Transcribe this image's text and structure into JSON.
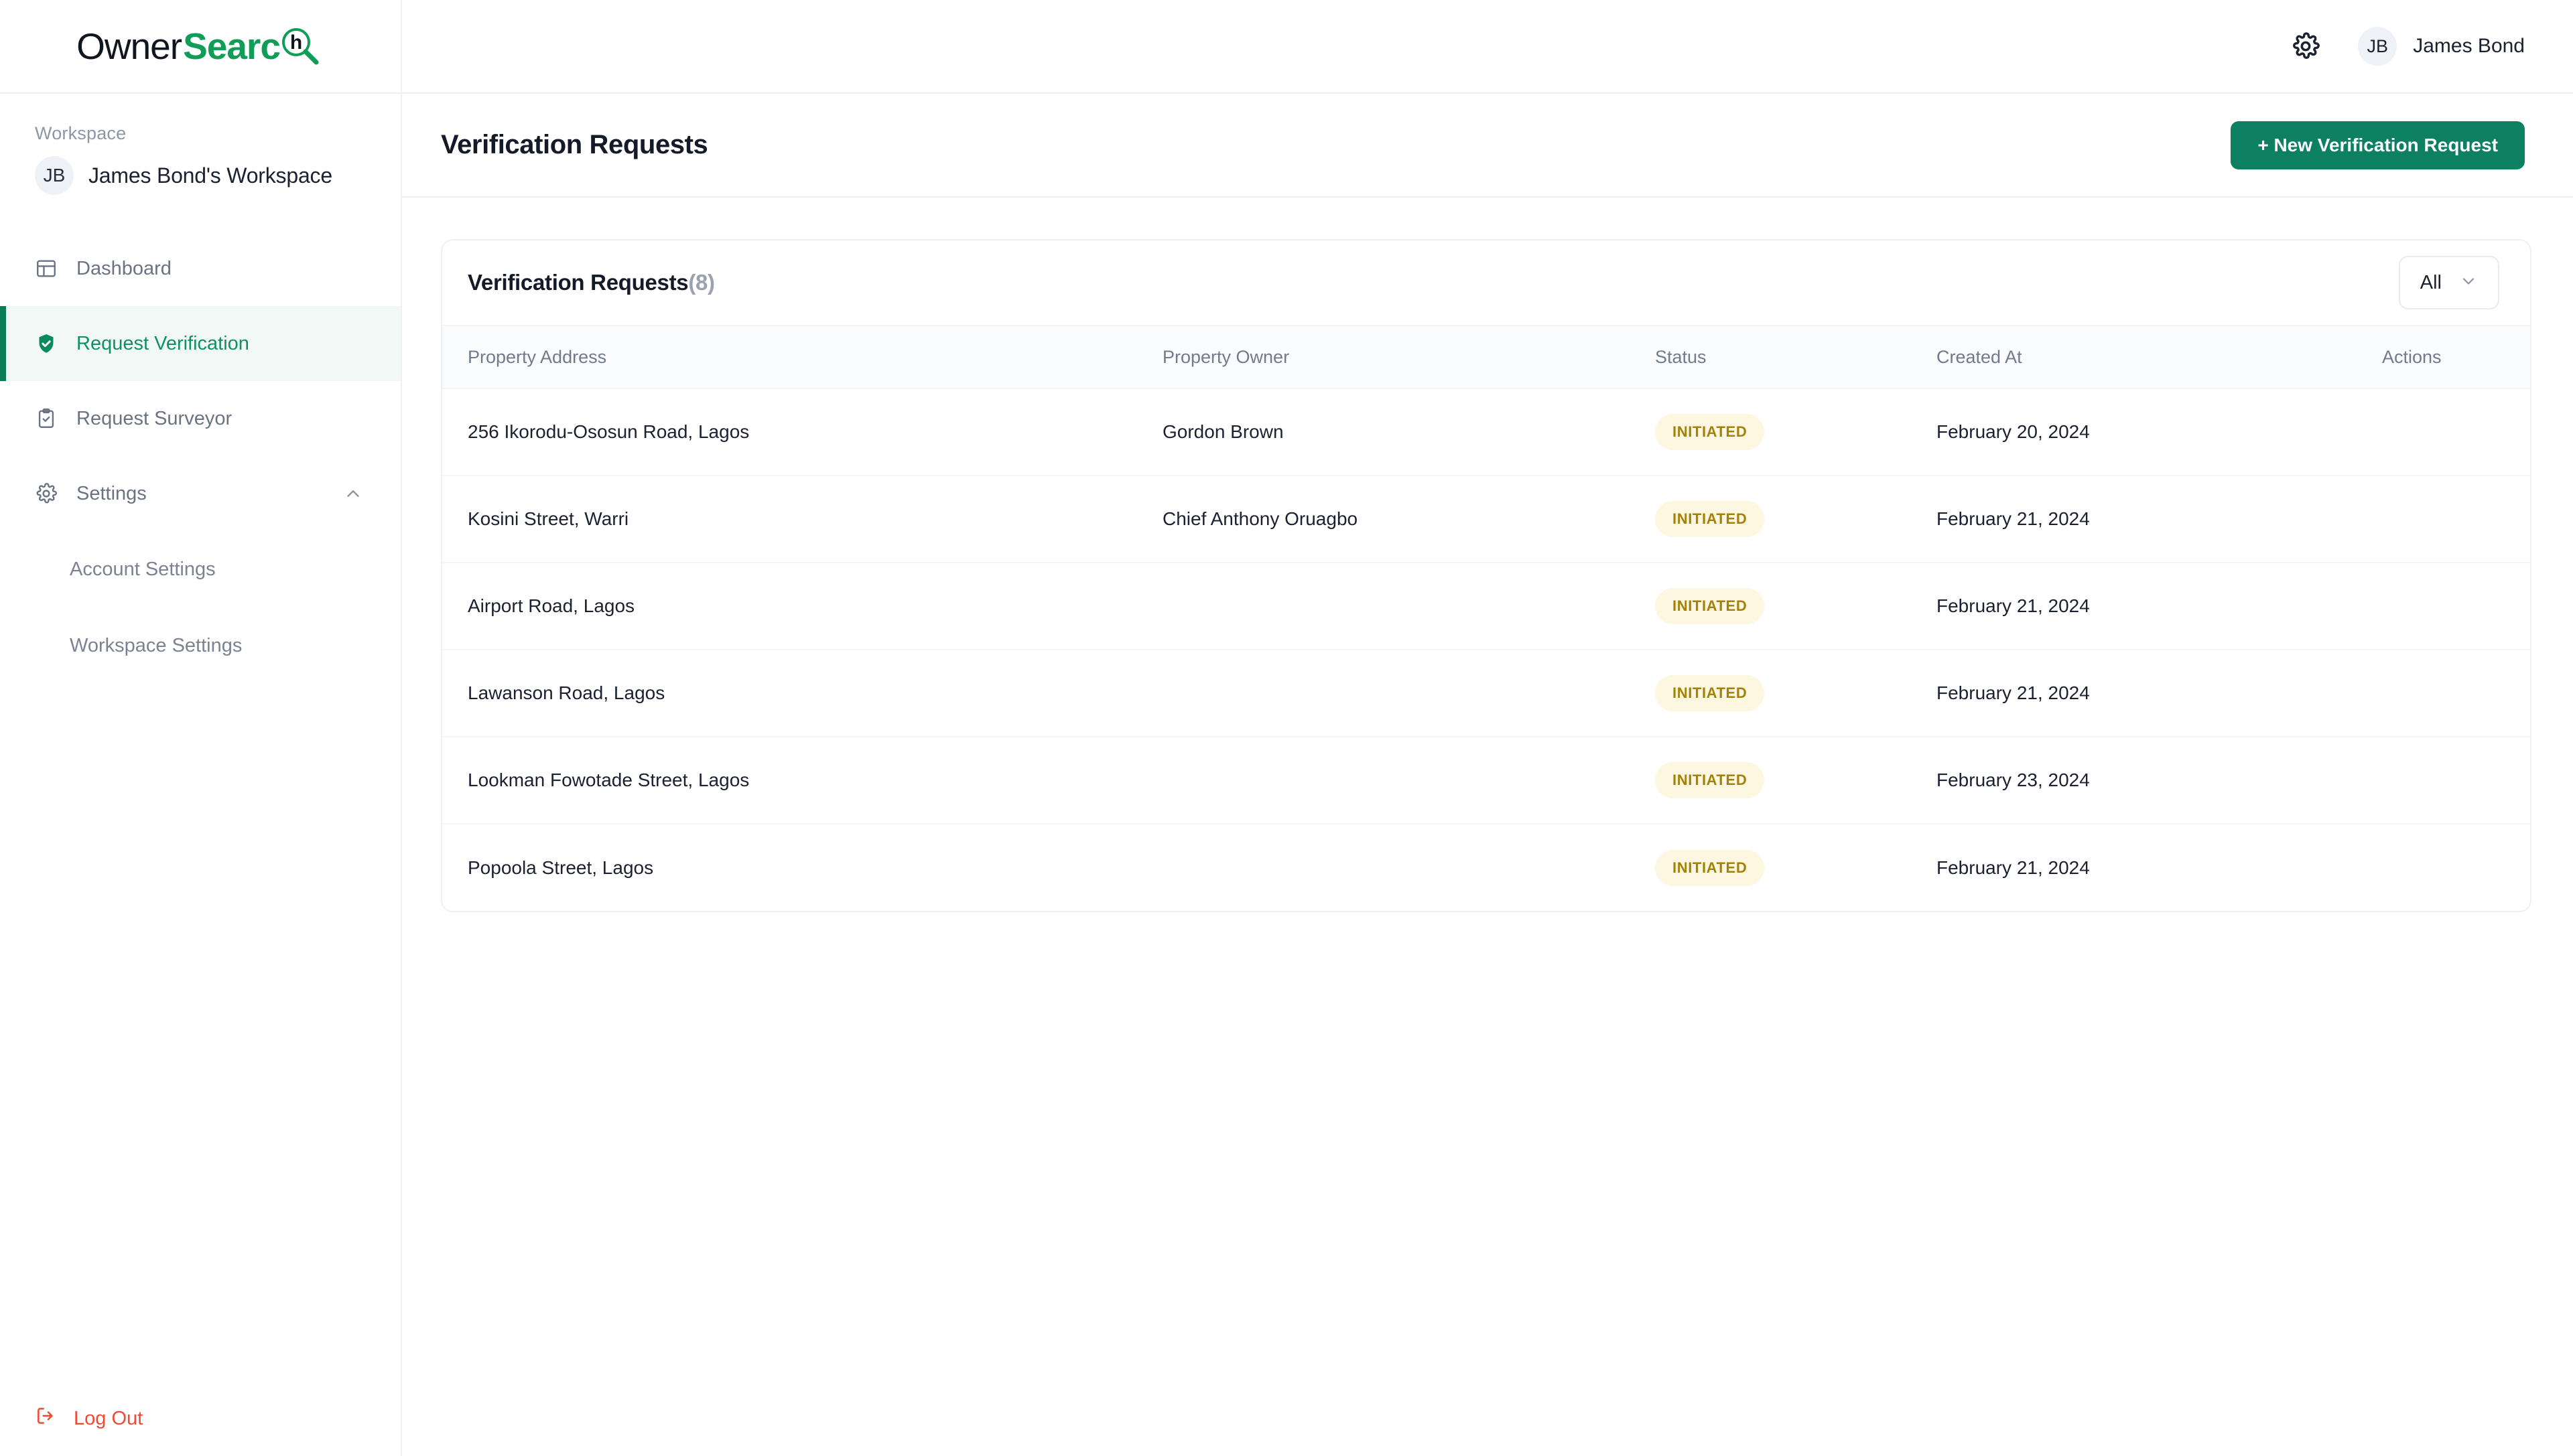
{
  "brand": {
    "logo_primary": "Owner",
    "logo_accent": "Searc",
    "logo_mark_letter": "h",
    "accent_color": "#0f9d58",
    "primary_green": "#0c8060"
  },
  "sidebar": {
    "workspace_label": "Workspace",
    "workspace_initials": "JB",
    "workspace_name": "James Bond's Workspace",
    "items": [
      {
        "label": "Dashboard",
        "icon": "grid-icon",
        "active": false
      },
      {
        "label": "Request Verification",
        "icon": "shield-check-icon",
        "active": true
      },
      {
        "label": "Request Surveyor",
        "icon": "clipboard-check-icon",
        "active": false
      },
      {
        "label": "Settings",
        "icon": "gear-icon",
        "active": false,
        "expanded": true
      }
    ],
    "settings_children": [
      {
        "label": "Account Settings"
      },
      {
        "label": "Workspace Settings"
      }
    ],
    "logout_label": "Log Out",
    "logout_color": "#ef4a33"
  },
  "topbar": {
    "settings_icon": "gear-icon",
    "user_initials": "JB",
    "user_name": "James Bond"
  },
  "page": {
    "title": "Verification Requests",
    "new_request_button": "+ New Verification Request"
  },
  "card": {
    "title": "Verification Requests",
    "count": "(8)",
    "filter_value": "All",
    "filter_icon": "chevron-down-icon"
  },
  "table": {
    "columns": [
      "Property Address",
      "Property Owner",
      "Status",
      "Created At",
      "Actions"
    ],
    "rows": [
      {
        "address": "256 Ikorodu-Ososun Road, Lagos",
        "owner": "Gordon Brown",
        "status": "INITIATED",
        "created_at": "February 20, 2024",
        "actions": ""
      },
      {
        "address": "Kosini Street, Warri",
        "owner": "Chief Anthony Oruagbo",
        "status": "INITIATED",
        "created_at": "February 21, 2024",
        "actions": ""
      },
      {
        "address": "Airport Road, Lagos",
        "owner": "",
        "status": "INITIATED",
        "created_at": "February 21, 2024",
        "actions": ""
      },
      {
        "address": "Lawanson Road, Lagos",
        "owner": "",
        "status": "INITIATED",
        "created_at": "February 21, 2024",
        "actions": ""
      },
      {
        "address": "Lookman Fowotade Street, Lagos",
        "owner": "",
        "status": "INITIATED",
        "created_at": "February 23, 2024",
        "actions": ""
      },
      {
        "address": "Popoola Street, Lagos",
        "owner": "",
        "status": "INITIATED",
        "created_at": "February 21, 2024",
        "actions": ""
      }
    ],
    "status_badge_colors": {
      "background": "#fdf6e0",
      "text": "#a3820b"
    }
  }
}
